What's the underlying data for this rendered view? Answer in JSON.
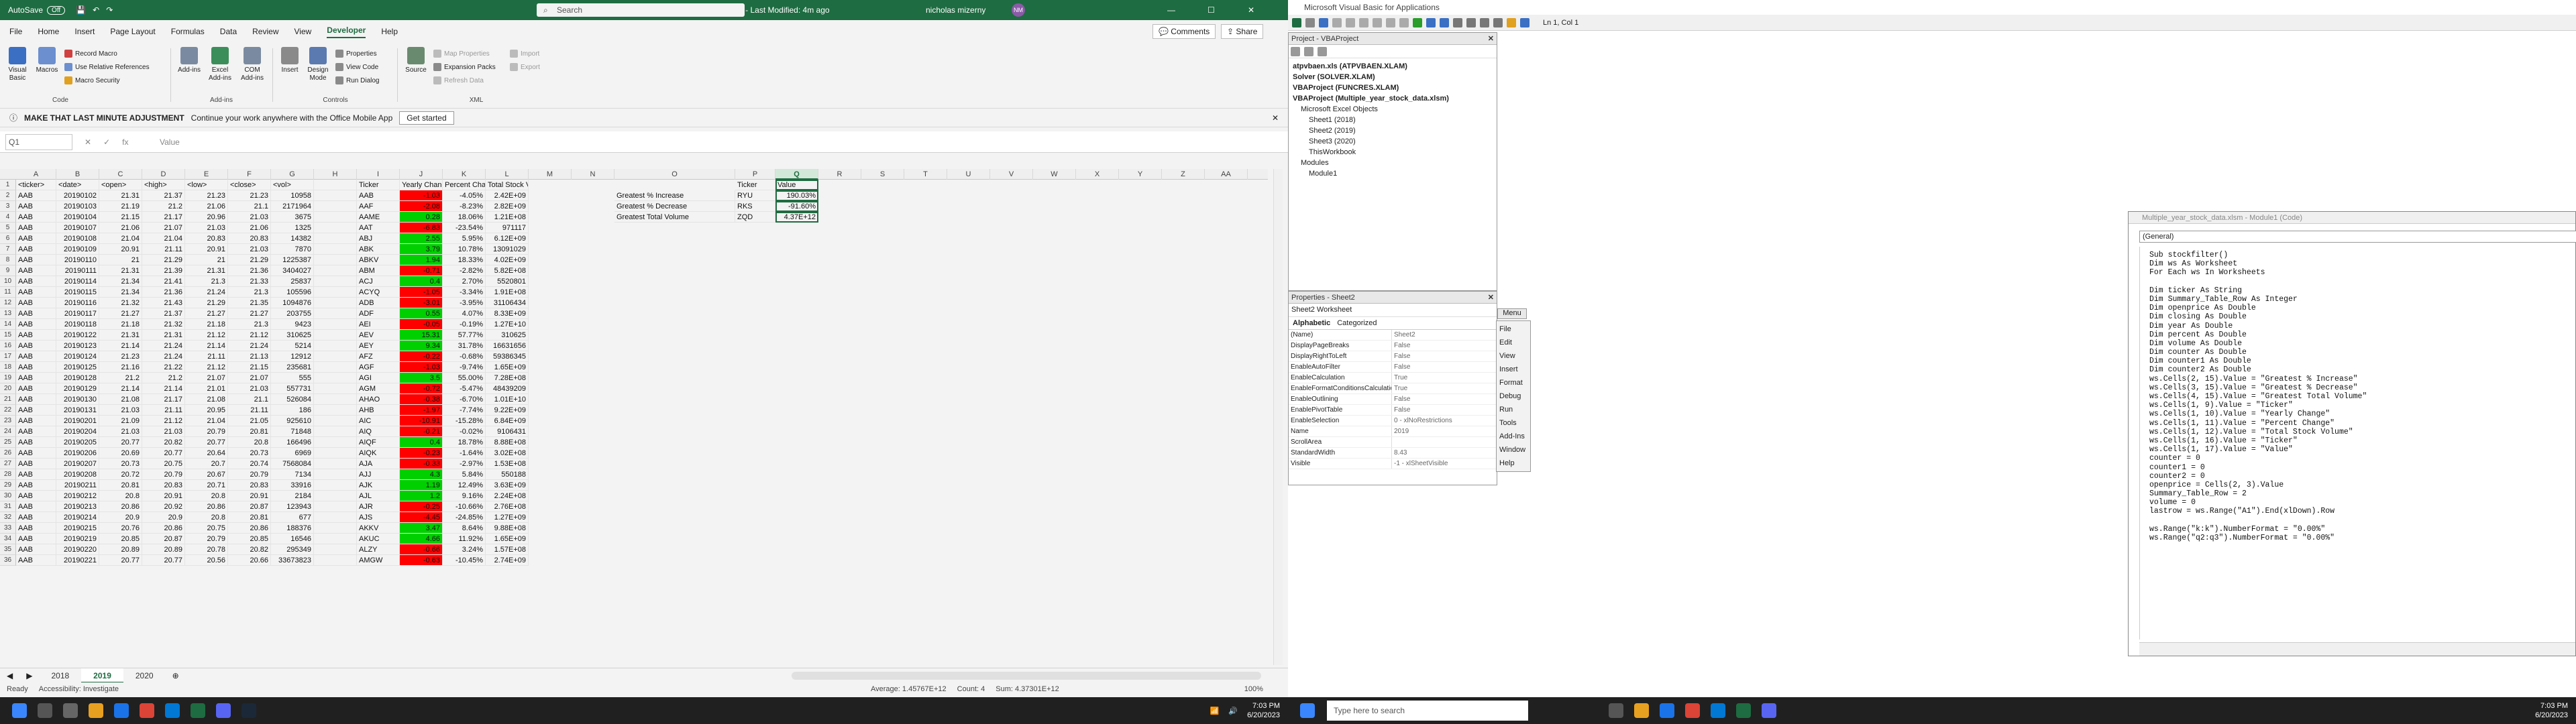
{
  "excel": {
    "title": "Multiple_year_stock_data - Last Modified: 4m ago",
    "autosave": "AutoSave",
    "autosave_state": "Off",
    "search": "Search",
    "user": "nicholas mizerny",
    "user_initials": "NM",
    "comments": "Comments",
    "share": "Share",
    "menus": [
      "File",
      "Home",
      "Insert",
      "Page Layout",
      "Formulas",
      "Data",
      "Review",
      "View",
      "Developer",
      "Help"
    ],
    "ribbon": {
      "visual_basic": "Visual Basic",
      "macros": "Macros",
      "record_macro": "Record Macro",
      "relative": "Use Relative References",
      "macro_security": "Macro Security",
      "code_group": "Code",
      "addins": "Add-ins",
      "excel_addins": "Excel Add-ins",
      "com_addins": "COM Add-ins",
      "addins_group": "Add-ins",
      "insert": "Insert",
      "design_mode": "Design Mode",
      "properties": "Properties",
      "view_code": "View Code",
      "run_dialog": "Run Dialog",
      "controls_group": "Controls",
      "source": "Source",
      "map_properties": "Map Properties",
      "expansion_packs": "Expansion Packs",
      "refresh_data": "Refresh Data",
      "import": "Import",
      "export": "Export",
      "xml_group": "XML"
    },
    "msg": {
      "title": "MAKE THAT LAST MINUTE ADJUSTMENT",
      "text": "Continue your work anywhere with the Office Mobile App",
      "button": "Get started"
    },
    "namebox": "Q1",
    "formula": "Value",
    "columns": [
      "A",
      "B",
      "C",
      "D",
      "E",
      "F",
      "G",
      "H",
      "I",
      "J",
      "K",
      "L",
      "M",
      "N",
      "O",
      "P",
      "Q",
      "R",
      "S",
      "T",
      "U",
      "V",
      "W",
      "X",
      "Y",
      "Z",
      "AA"
    ],
    "rows": [
      [
        "<ticker>",
        "<date>",
        "<open>",
        "<high>",
        "<low>",
        "<close>",
        "<vol>",
        "",
        "Ticker",
        "Yearly Change",
        "Percent Change",
        "Total Stock Volume"
      ],
      [
        "AAB",
        "20190102",
        "21.31",
        "21.37",
        "21.23",
        "21.23",
        "10958",
        "",
        "AAB",
        "-1.03",
        "-4.05%",
        "2.42E+09"
      ],
      [
        "AAB",
        "20190103",
        "21.19",
        "21.2",
        "21.06",
        "21.1",
        "2171964",
        "",
        "AAF",
        "-2.08",
        "-8.23%",
        "2.82E+09"
      ],
      [
        "AAB",
        "20190104",
        "21.15",
        "21.17",
        "20.96",
        "21.03",
        "3675",
        "",
        "AAME",
        "0.28",
        "18.06%",
        "1.21E+08"
      ],
      [
        "AAB",
        "20190107",
        "21.06",
        "21.07",
        "21.03",
        "21.06",
        "1325",
        "",
        "AAT",
        "-6.83",
        "-23.54%",
        "971117"
      ],
      [
        "AAB",
        "20190108",
        "21.04",
        "21.04",
        "20.83",
        "20.83",
        "14382",
        "",
        "ABJ",
        "2.55",
        "5.95%",
        "6.12E+09"
      ],
      [
        "AAB",
        "20190109",
        "20.91",
        "21.11",
        "20.91",
        "21.03",
        "7870",
        "",
        "ABK",
        "3.79",
        "10.78%",
        "13091029"
      ],
      [
        "AAB",
        "20190110",
        "21",
        "21.29",
        "21",
        "21.29",
        "1225387",
        "",
        "ABKV",
        "1.94",
        "18.33%",
        "4.02E+09"
      ],
      [
        "AAB",
        "20190111",
        "21.31",
        "21.39",
        "21.31",
        "21.36",
        "3404027",
        "",
        "ABM",
        "-0.71",
        "-2.82%",
        "5.82E+08"
      ],
      [
        "AAB",
        "20190114",
        "21.34",
        "21.41",
        "21.3",
        "21.33",
        "25837",
        "",
        "ACJ",
        "0.4",
        "2.70%",
        "5520801"
      ],
      [
        "AAB",
        "20190115",
        "21.34",
        "21.36",
        "21.24",
        "21.3",
        "105596",
        "",
        "ACYQ",
        "-1.05",
        "-3.34%",
        "1.91E+08"
      ],
      [
        "AAB",
        "20190116",
        "21.32",
        "21.43",
        "21.29",
        "21.35",
        "1094876",
        "",
        "ADB",
        "-3.01",
        "-3.95%",
        "31106434"
      ],
      [
        "AAB",
        "20190117",
        "21.27",
        "21.37",
        "21.27",
        "21.27",
        "203755",
        "",
        "ADF",
        "0.55",
        "4.07%",
        "8.33E+09"
      ],
      [
        "AAB",
        "20190118",
        "21.18",
        "21.32",
        "21.18",
        "21.3",
        "9423",
        "",
        "AEI",
        "-0.05",
        "-0.19%",
        "1.27E+10"
      ],
      [
        "AAB",
        "20190122",
        "21.31",
        "21.31",
        "21.12",
        "21.12",
        "310625",
        "",
        "AEV",
        "15.31",
        "57.77%",
        "310625"
      ],
      [
        "AAB",
        "20190123",
        "21.14",
        "21.24",
        "21.14",
        "21.24",
        "5214",
        "",
        "AEY",
        "9.34",
        "31.78%",
        "16631656"
      ],
      [
        "AAB",
        "20190124",
        "21.23",
        "21.24",
        "21.11",
        "21.13",
        "12912",
        "",
        "AFZ",
        "-0.22",
        "-0.68%",
        "59386345"
      ],
      [
        "AAB",
        "20190125",
        "21.16",
        "21.22",
        "21.12",
        "21.15",
        "235681",
        "",
        "AGF",
        "-1.03",
        "-9.74%",
        "1.65E+09"
      ],
      [
        "AAB",
        "20190128",
        "21.2",
        "21.2",
        "21.07",
        "21.07",
        "555",
        "",
        "AGI",
        "3.5",
        "55.00%",
        "7.28E+08"
      ],
      [
        "AAB",
        "20190129",
        "21.14",
        "21.14",
        "21.01",
        "21.03",
        "557731",
        "",
        "AGM",
        "-0.72",
        "-5.47%",
        "48439209"
      ],
      [
        "AAB",
        "20190130",
        "21.08",
        "21.17",
        "21.08",
        "21.1",
        "526084",
        "",
        "AHAO",
        "-0.38",
        "-6.70%",
        "1.01E+10"
      ],
      [
        "AAB",
        "20190131",
        "21.03",
        "21.11",
        "20.95",
        "21.11",
        "186",
        "",
        "AHB",
        "-1.97",
        "-7.74%",
        "9.22E+09"
      ],
      [
        "AAB",
        "20190201",
        "21.09",
        "21.12",
        "21.04",
        "21.05",
        "925610",
        "",
        "AIC",
        "-10.91",
        "-15.28%",
        "6.84E+09"
      ],
      [
        "AAB",
        "20190204",
        "21.03",
        "21.03",
        "20.79",
        "20.81",
        "71848",
        "",
        "AIQ",
        "-0.21",
        "-0.02%",
        "9106431"
      ],
      [
        "AAB",
        "20190205",
        "20.77",
        "20.82",
        "20.77",
        "20.8",
        "166496",
        "",
        "AIQF",
        "0.4",
        "18.78%",
        "8.88E+08"
      ],
      [
        "AAB",
        "20190206",
        "20.69",
        "20.77",
        "20.64",
        "20.73",
        "6969",
        "",
        "AIQK",
        "-0.23",
        "-1.64%",
        "3.02E+08"
      ],
      [
        "AAB",
        "20190207",
        "20.73",
        "20.75",
        "20.7",
        "20.74",
        "7568084",
        "",
        "AJA",
        "-0.33",
        "-2.97%",
        "1.53E+08"
      ],
      [
        "AAB",
        "20190208",
        "20.72",
        "20.79",
        "20.67",
        "20.79",
        "7134",
        "",
        "AJJ",
        "4.3",
        "5.84%",
        "550188"
      ],
      [
        "AAB",
        "20190211",
        "20.81",
        "20.83",
        "20.71",
        "20.83",
        "33916",
        "",
        "AJK",
        "1.19",
        "12.49%",
        "3.63E+09"
      ],
      [
        "AAB",
        "20190212",
        "20.8",
        "20.91",
        "20.8",
        "20.91",
        "2184",
        "",
        "AJL",
        "1.2",
        "9.16%",
        "2.24E+08"
      ],
      [
        "AAB",
        "20190213",
        "20.86",
        "20.92",
        "20.86",
        "20.87",
        "123943",
        "",
        "AJR",
        "-0.25",
        "-10.66%",
        "2.76E+08"
      ],
      [
        "AAB",
        "20190214",
        "20.9",
        "20.9",
        "20.8",
        "20.81",
        "677",
        "",
        "AJS",
        "-4.45",
        "-24.85%",
        "1.27E+09"
      ],
      [
        "AAB",
        "20190215",
        "20.76",
        "20.86",
        "20.75",
        "20.86",
        "188376",
        "",
        "AKKV",
        "3.47",
        "8.64%",
        "9.88E+08"
      ],
      [
        "AAB",
        "20190219",
        "20.85",
        "20.87",
        "20.79",
        "20.85",
        "16546",
        "",
        "AKUC",
        "4.66",
        "11.92%",
        "1.65E+09"
      ],
      [
        "AAB",
        "20190220",
        "20.89",
        "20.89",
        "20.78",
        "20.82",
        "295349",
        "",
        "ALZY",
        "-0.66",
        "3.24%",
        "1.57E+08"
      ],
      [
        "AAB",
        "20190221",
        "20.77",
        "20.77",
        "20.56",
        "20.66",
        "33673823",
        "",
        "AMGW",
        "-0.63",
        "-10.45%",
        "2.74E+09"
      ]
    ],
    "greatest": [
      {
        "label": "Greatest % Increase",
        "ticker": "RYU",
        "value": "190.03%"
      },
      {
        "label": "Greatest % Decrease",
        "ticker": "RKS",
        "value": "-91.60%"
      },
      {
        "label": "Greatest Total Volume",
        "ticker": "ZQD",
        "value": "4.37E+12"
      }
    ],
    "summary_header": {
      "ticker": "Ticker",
      "value": "Value"
    },
    "sheets": [
      "2018",
      "2019",
      "2020"
    ],
    "active_sheet": "2019",
    "status": {
      "ready": "Ready",
      "accessibility": "Accessibility: Investigate",
      "average": "Average: 1.45767E+12",
      "count": "Count: 4",
      "sum": "Sum: 4.37301E+12",
      "zoom": "100%"
    },
    "time": "7:03 PM",
    "date": "6/20/2023"
  },
  "vba": {
    "title": "Microsoft Visual Basic for Applications",
    "position": "Ln 1, Col 1",
    "project_title": "Project - VBAProject",
    "tree": [
      {
        "label": "atpvbaen.xls (ATPVBAEN.XLAM)",
        "bold": true,
        "indent": 0
      },
      {
        "label": "Solver (SOLVER.XLAM)",
        "bold": true,
        "indent": 0
      },
      {
        "label": "VBAProject (FUNCRES.XLAM)",
        "bold": true,
        "indent": 0
      },
      {
        "label": "VBAProject (Multiple_year_stock_data.xlsm)",
        "bold": true,
        "indent": 0
      },
      {
        "label": "Microsoft Excel Objects",
        "bold": false,
        "indent": 1
      },
      {
        "label": "Sheet1 (2018)",
        "bold": false,
        "indent": 2
      },
      {
        "label": "Sheet2 (2019)",
        "bold": false,
        "indent": 2
      },
      {
        "label": "Sheet3 (2020)",
        "bold": false,
        "indent": 2
      },
      {
        "label": "ThisWorkbook",
        "bold": false,
        "indent": 2
      },
      {
        "label": "Modules",
        "bold": false,
        "indent": 1
      },
      {
        "label": "Module1",
        "bold": false,
        "indent": 2
      }
    ],
    "props_title": "Properties - Sheet2",
    "props_object": "Sheet2 Worksheet",
    "props_tabs": [
      "Alphabetic",
      "Categorized"
    ],
    "props": [
      [
        "(Name)",
        "Sheet2"
      ],
      [
        "DisplayPageBreaks",
        "False"
      ],
      [
        "DisplayRightToLeft",
        "False"
      ],
      [
        "EnableAutoFilter",
        "False"
      ],
      [
        "EnableCalculation",
        "True"
      ],
      [
        "EnableFormatConditionsCalculation",
        "True"
      ],
      [
        "EnableOutlining",
        "False"
      ],
      [
        "EnablePivotTable",
        "False"
      ],
      [
        "EnableSelection",
        "0 - xlNoRestrictions"
      ],
      [
        "Name",
        "2019"
      ],
      [
        "ScrollArea",
        ""
      ],
      [
        "StandardWidth",
        "8.43"
      ],
      [
        "Visible",
        "-1 - xlSheetVisible"
      ]
    ],
    "menu_button": "Menu",
    "menu": [
      "File",
      "Edit",
      "View",
      "Insert",
      "Format",
      "Debug",
      "Run",
      "Tools",
      "Add-Ins",
      "Window",
      "Help"
    ],
    "code_title": "Multiple_year_stock_data.xlsm - Module1 (Code)",
    "code_obj": "(General)",
    "code_proc": "stockfilter",
    "code": [
      "Sub stockfilter()",
      "Dim ws As Worksheet",
      "For Each ws In Worksheets",
      "",
      "Dim ticker As String",
      "Dim Summary_Table_Row As Integer",
      "Dim openprice As Double",
      "Dim closing As Double",
      "Dim year As Double",
      "Dim percent As Double",
      "Dim volume As Double",
      "Dim counter As Double",
      "Dim counter1 As Double",
      "Dim counter2 As Double",
      "ws.Cells(2, 15).Value = \"Greatest % Increase\"",
      "ws.Cells(3, 15).Value = \"Greatest % Decrease\"",
      "ws.Cells(4, 15).Value = \"Greatest Total Volume\"",
      "ws.Cells(1, 9).Value = \"Ticker\"",
      "ws.Cells(1, 10).Value = \"Yearly Change\"",
      "ws.Cells(1, 11).Value = \"Percent Change\"",
      "ws.Cells(1, 12).Value = \"Total Stock Volume\"",
      "ws.Cells(1, 16).Value = \"Ticker\"",
      "ws.Cells(1, 17).Value = \"Value\"",
      "counter = 0",
      "counter1 = 0",
      "counter2 = 0",
      "openprice = Cells(2, 3).Value",
      "Summary_Table_Row = 2",
      "volume = 0",
      "lastrow = ws.Range(\"A1\").End(xlDown).Row",
      "",
      "ws.Range(\"k:k\").NumberFormat = \"0.00%\"",
      "ws.Range(\"q2:q3\").NumberFormat = \"0.00%\""
    ],
    "search": "Type here to search",
    "time": "7:03 PM",
    "date": "6/20/2023"
  }
}
